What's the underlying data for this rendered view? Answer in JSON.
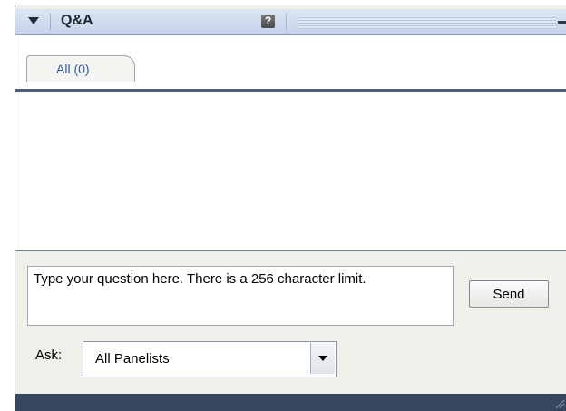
{
  "panel": {
    "title": "Q&A",
    "help_glyph": "?",
    "icons": {
      "collapse": "triangle-down-icon",
      "help": "question-mark-icon",
      "minimize": "minimize-icon",
      "resize": "resize-grip-icon"
    }
  },
  "tabs": [
    {
      "label": "All (0)",
      "selected": true
    }
  ],
  "question_list": [],
  "question_input": {
    "value": "Type your question here. There is a 256 character limit."
  },
  "send": {
    "label": "Send"
  },
  "ask": {
    "label": "Ask:",
    "selected": "All Panelists"
  },
  "colors": {
    "header": "#c9d7ea",
    "footer": "#34475f",
    "tab_text": "#2a5aa8",
    "panel_bg": "#f0f0ea"
  }
}
